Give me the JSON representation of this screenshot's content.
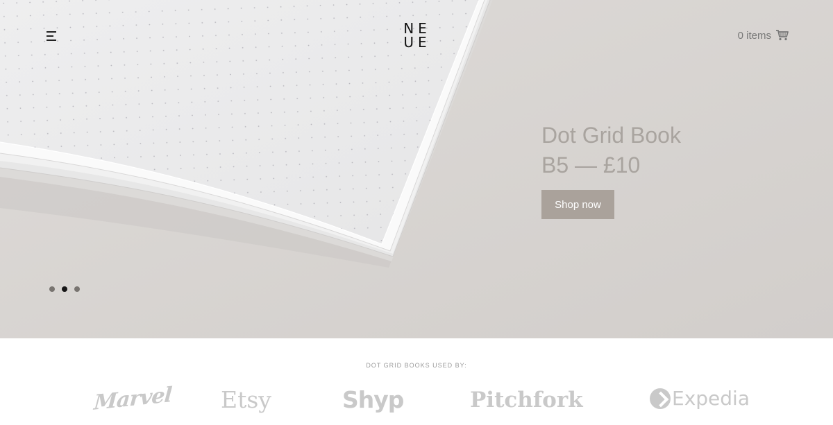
{
  "header": {
    "menu_icon": "hamburger-menu-icon",
    "logo_line1": "NE",
    "logo_line2": "UE",
    "cart_label": "0 items",
    "cart_icon": "shopping-cart-icon"
  },
  "hero": {
    "title_line1": "Dot Grid Book",
    "title_line2": "B5 — £10",
    "cta_label": "Shop now",
    "carousel": {
      "total": 3,
      "active": 2
    },
    "colors": {
      "background": "#d8d4d1",
      "button": "#aaa29b",
      "title": "#a9a49f"
    }
  },
  "brands": {
    "heading": "DOT GRID BOOKS USED BY:",
    "items": [
      {
        "name": "Marvel"
      },
      {
        "name": "Etsy"
      },
      {
        "name": "Shyp"
      },
      {
        "name": "Pitchfork"
      },
      {
        "name": "Expedia"
      }
    ]
  }
}
